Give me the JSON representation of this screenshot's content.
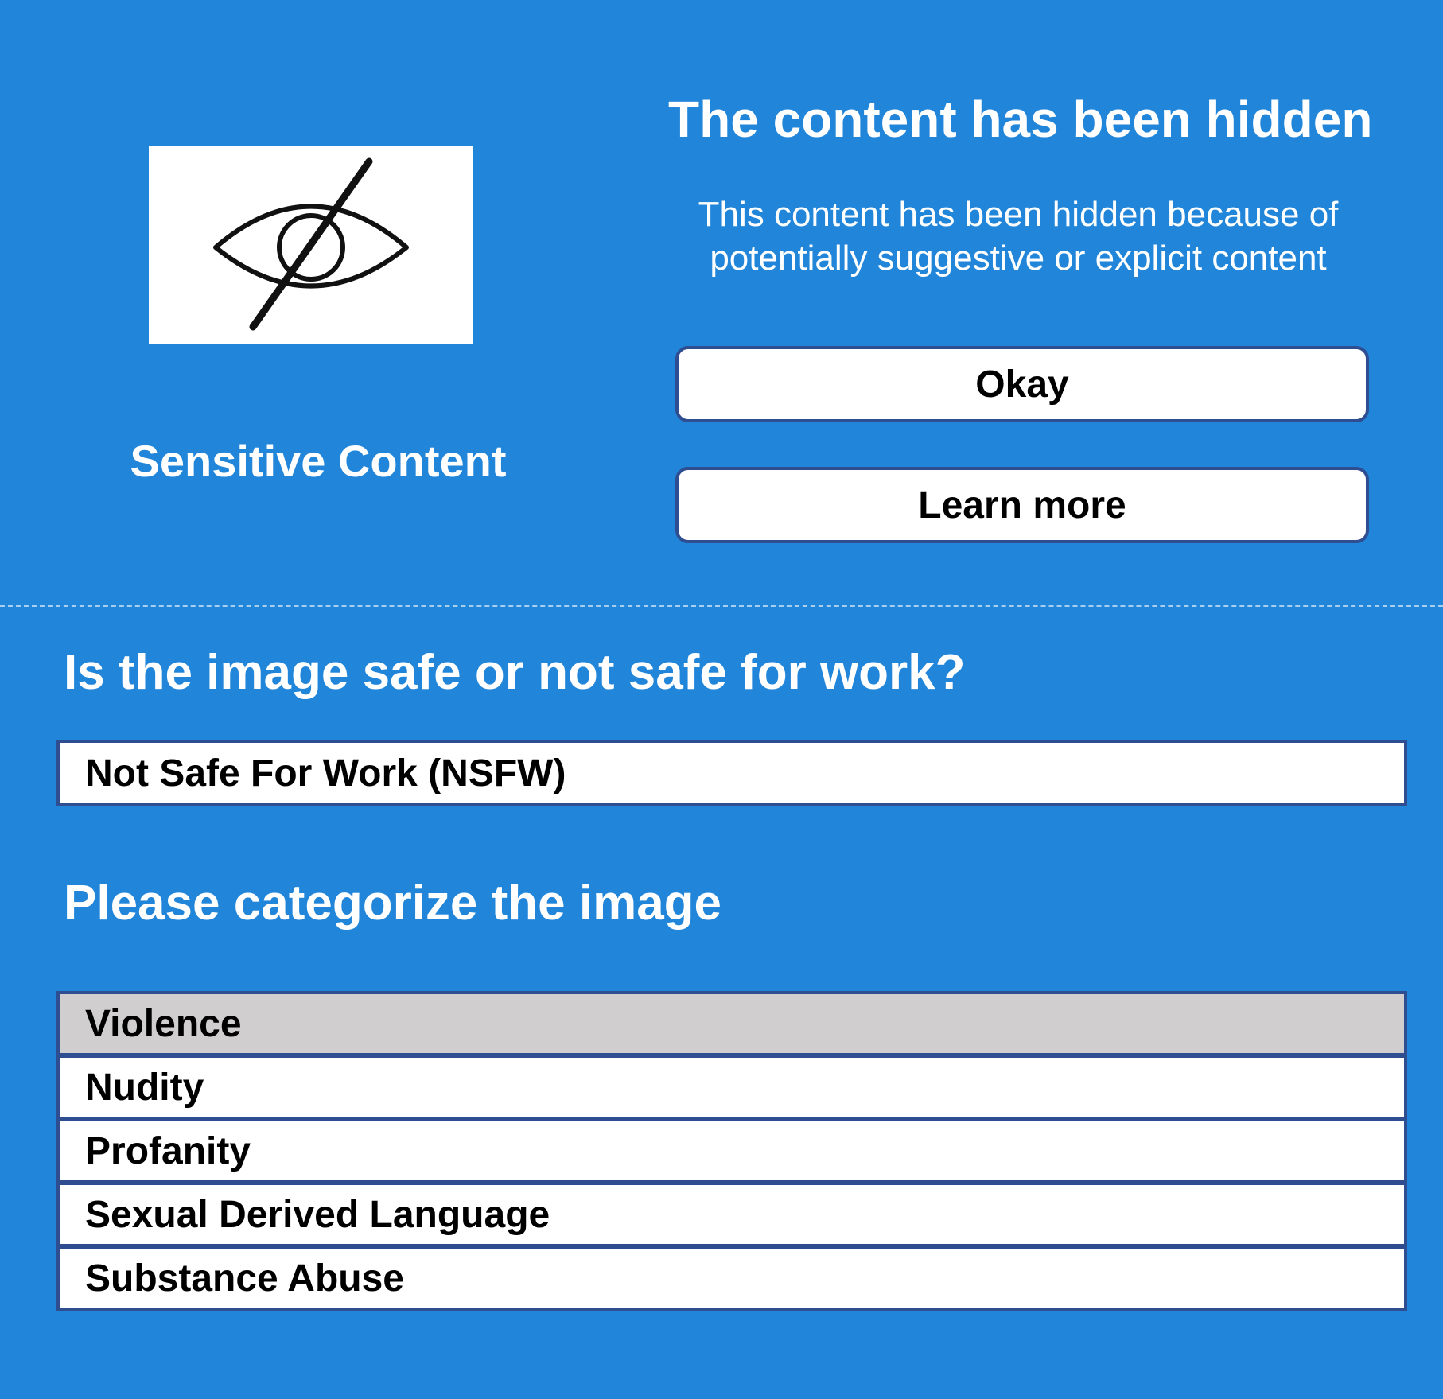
{
  "sensitive_panel": {
    "icon": "eye-slash-icon",
    "label": "Sensitive Content"
  },
  "notice": {
    "title": "The content has been hidden",
    "description": "This content has been hidden because of potentially suggestive or explicit content",
    "okay_label": "Okay",
    "learn_more_label": "Learn more"
  },
  "safety_question": {
    "label": "Is the image safe or not safe for work?",
    "selected_value": "Not Safe For Work (NSFW)"
  },
  "categorize": {
    "label": "Please categorize the image",
    "options": [
      {
        "label": "Violence",
        "selected": true
      },
      {
        "label": "Nudity",
        "selected": false
      },
      {
        "label": "Profanity",
        "selected": false
      },
      {
        "label": "Sexual Derived Language",
        "selected": false
      },
      {
        "label": "Substance Abuse",
        "selected": false
      }
    ]
  },
  "colors": {
    "background": "#2186da",
    "border": "#2f4d91",
    "selected_row": "#d0cece"
  }
}
